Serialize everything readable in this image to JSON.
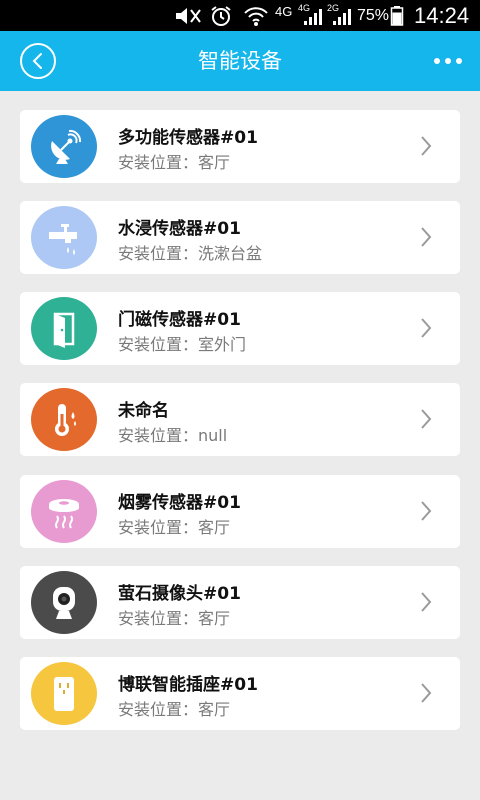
{
  "status_bar": {
    "network_4g": "4G",
    "sim1_tech": "4G",
    "sim2_tech": "2G",
    "battery": "75%",
    "time": "14:24"
  },
  "header": {
    "title": "智能设备",
    "back_icon": "chevron-left-icon",
    "more_icon": "more-horizontal-icon"
  },
  "devices": [
    {
      "name": "多功能传感器#01",
      "location": "安装位置：客厅",
      "icon": "satellite-dish-icon",
      "color": "#2f95d6"
    },
    {
      "name": "水浸传感器#01",
      "location": "安装位置：洗漱台盆",
      "icon": "faucet-icon",
      "color": "#adc8f5"
    },
    {
      "name": "门磁传感器#01",
      "location": "安装位置：室外门",
      "icon": "door-icon",
      "color": "#2fb196"
    },
    {
      "name": "未命名",
      "location": "安装位置：null",
      "icon": "thermometer-icon",
      "color": "#e36a2c"
    },
    {
      "name": "烟雾传感器#01",
      "location": "安装位置：客厅",
      "icon": "smoke-detector-icon",
      "color": "#e89bd1"
    },
    {
      "name": "萤石摄像头#01",
      "location": "安装位置：客厅",
      "icon": "camera-icon",
      "color": "#4b4b4b"
    },
    {
      "name": "博联智能插座#01",
      "location": "安装位置：客厅",
      "icon": "smart-plug-icon",
      "color": "#f5c63e"
    }
  ]
}
